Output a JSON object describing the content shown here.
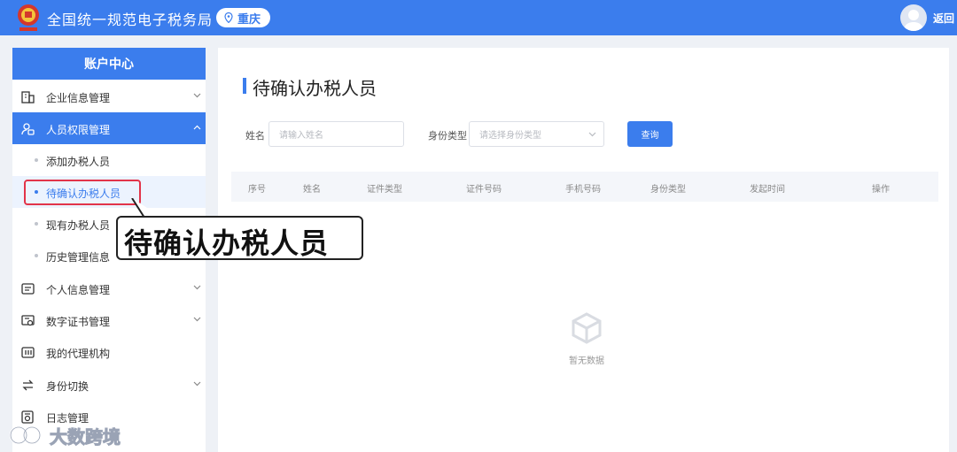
{
  "header": {
    "site_title": "全国统一规范电子税务局",
    "region": "重庆",
    "back_label": "返回"
  },
  "sidebar": {
    "title": "账户中心",
    "items": [
      {
        "label": "企业信息管理",
        "icon": "building-icon",
        "expandable": true
      },
      {
        "label": "人员权限管理",
        "icon": "person-key-icon",
        "expandable": true,
        "active": true
      },
      {
        "label": "个人信息管理",
        "icon": "id-card-icon",
        "expandable": true
      },
      {
        "label": "数字证书管理",
        "icon": "certificate-icon",
        "expandable": true
      },
      {
        "label": "我的代理机构",
        "icon": "agency-icon",
        "expandable": false
      },
      {
        "label": "身份切换",
        "icon": "switch-icon",
        "expandable": true
      },
      {
        "label": "日志管理",
        "icon": "log-icon",
        "expandable": false
      }
    ],
    "subitems": [
      {
        "label": "添加办税人员"
      },
      {
        "label": "待确认办税人员",
        "current": true
      },
      {
        "label": "现有办税人员"
      },
      {
        "label": "历史管理信息"
      }
    ]
  },
  "main": {
    "page_title": "待确认办税人员",
    "form": {
      "name_label": "姓名",
      "name_placeholder": "请输入姓名",
      "type_label": "身份类型",
      "type_placeholder": "请选择身份类型",
      "query_label": "查询"
    },
    "table": {
      "columns": [
        "序号",
        "姓名",
        "证件类型",
        "证件号码",
        "手机号码",
        "身份类型",
        "发起时间",
        "操作"
      ]
    },
    "empty_text": "暂无数据"
  },
  "callout": {
    "text": "待确认办税人员"
  },
  "watermark": {
    "text": "大数跨境"
  },
  "colors": {
    "primary": "#3b7ded",
    "highlight": "#e2344a"
  }
}
